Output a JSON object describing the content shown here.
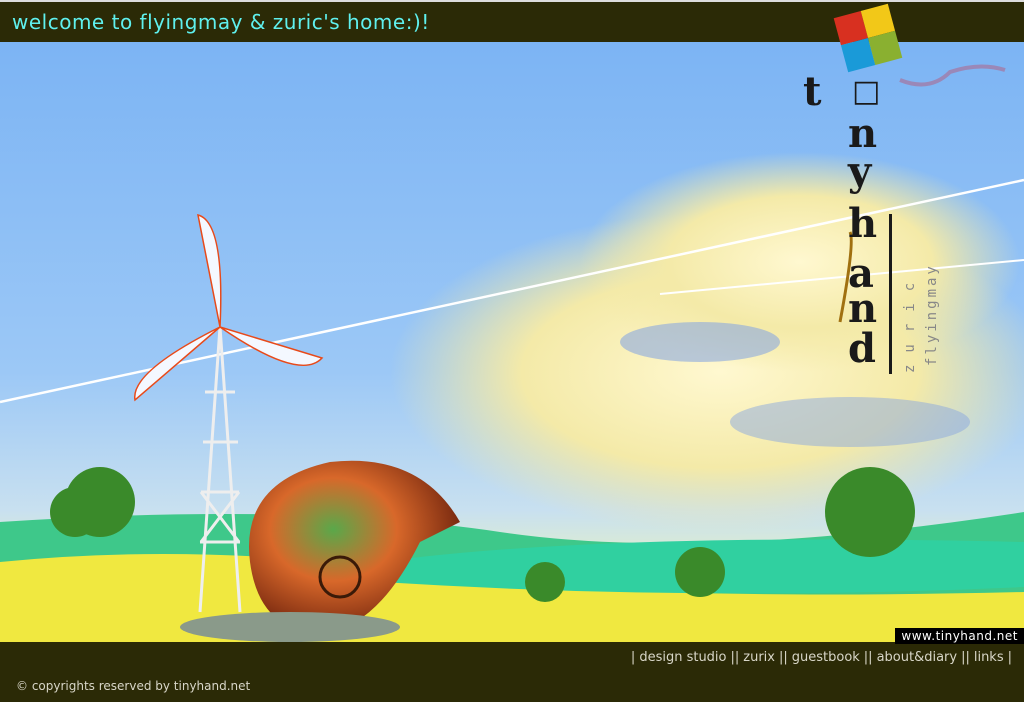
{
  "header": {
    "welcome": "welcome to flyingmay & zuric's home:)!"
  },
  "logo": {
    "letters": [
      "t",
      "□",
      "n",
      "y",
      "h",
      "a",
      "n",
      "d"
    ],
    "sub1": "zuric",
    "sub2": "flyingmay"
  },
  "footer": {
    "url": "www.tinyhand.net",
    "nav": [
      "design studio",
      "zurix",
      "guestbook",
      "about&diary",
      "links"
    ],
    "copyright": "© copyrights reserved by tinyhand.net"
  }
}
